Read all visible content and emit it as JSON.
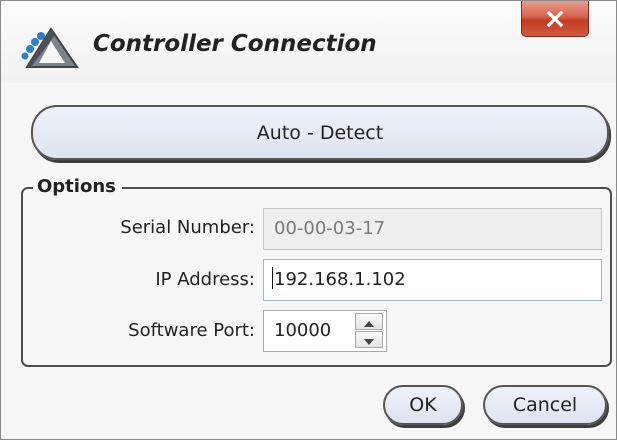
{
  "window": {
    "title": "Controller Connection",
    "close_icon": "close-x-icon",
    "app_icon": "controller-logo-icon",
    "close_button_color": "#c9432a"
  },
  "auto_detect": {
    "label": "Auto - Detect"
  },
  "options": {
    "legend": "Options",
    "serial_number": {
      "label": "Serial Number:",
      "value": "00-00-03-17",
      "disabled": true
    },
    "ip_address": {
      "label": "IP Address:",
      "value": "192.168.1.102",
      "focused": true
    },
    "software_port": {
      "label": "Software Port:",
      "value": "10000",
      "increment_icon": "spin-up-arrow-icon",
      "decrement_icon": "spin-down-arrow-icon"
    }
  },
  "buttons": {
    "ok_label": "OK",
    "cancel_label": "Cancel"
  },
  "colors": {
    "button_fill": "#e3e8f4",
    "focus_border": "#9cb8d9",
    "disabled_field_fill": "#eeeeee"
  }
}
